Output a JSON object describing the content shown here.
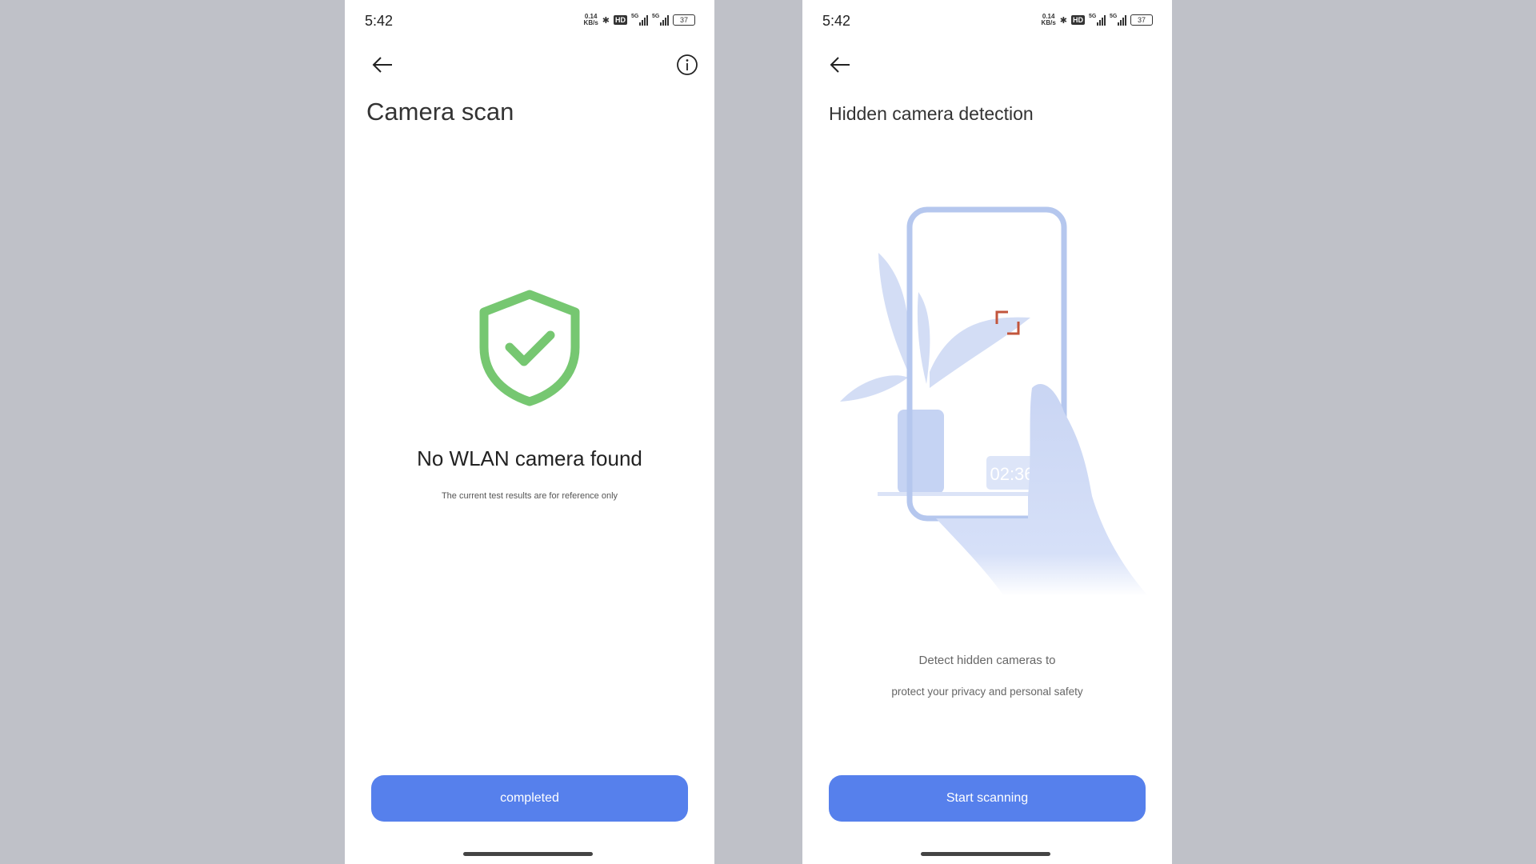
{
  "status_bar": {
    "time": "5:42",
    "net_speed_value": "0.14",
    "net_speed_unit": "KB/s",
    "hd_label": "HD",
    "sim1": "5G",
    "sim2": "5G",
    "battery": "37"
  },
  "screen1": {
    "title": "Camera scan",
    "result": "No WLAN camera found",
    "note": "The current test results are for reference only",
    "button": "completed",
    "icons": [
      "back-arrow-icon",
      "info-icon",
      "shield-check-icon"
    ],
    "shield_color": "#76c771"
  },
  "screen2": {
    "title": "Hidden camera detection",
    "timer": "02:36",
    "desc1": "Detect hidden cameras to",
    "desc2": "protect your privacy and personal safety",
    "button": "Start scanning",
    "icons": [
      "back-arrow-icon"
    ]
  },
  "colors": {
    "accent": "#5680ec",
    "background": "#bfc1c8",
    "bracket": "#c2553c"
  }
}
